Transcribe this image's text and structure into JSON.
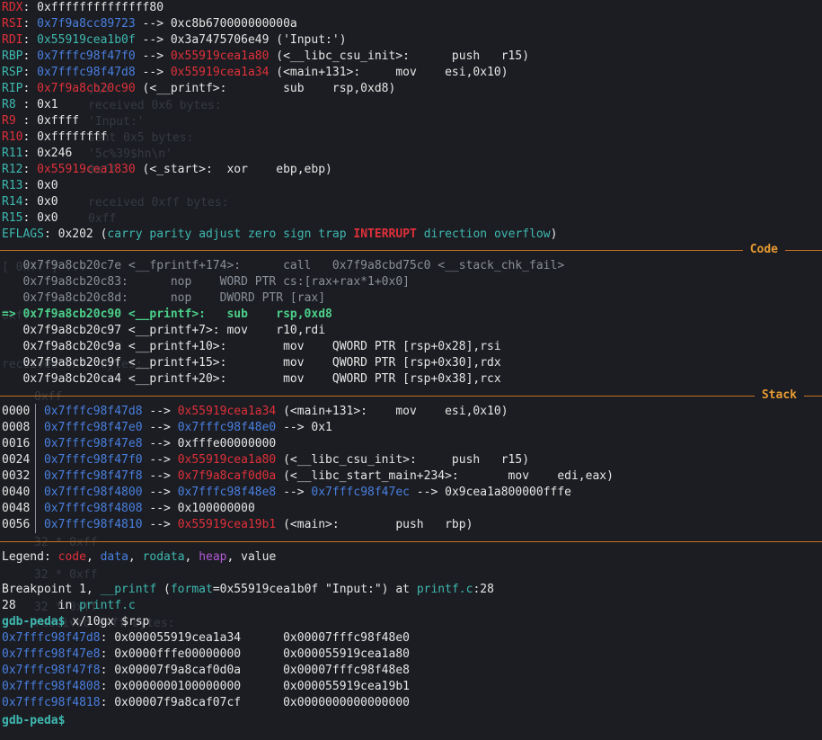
{
  "registers": [
    {
      "name": "RDX",
      "name_color": "red",
      "text": [
        [
          "0xffffffffffffff80",
          "white"
        ]
      ]
    },
    {
      "name": "RSI",
      "name_color": "red",
      "text": [
        [
          "0x7f9a8cc89723",
          "blue"
        ],
        [
          " --> 0xc8b670000000000a",
          "white"
        ]
      ]
    },
    {
      "name": "RDI",
      "name_color": "red",
      "text": [
        [
          "0x55919cea1b0f",
          "teal"
        ],
        [
          " --> 0x3a7475706e49 ('Input:')",
          "white"
        ]
      ]
    },
    {
      "name": "RBP",
      "name_color": "teal",
      "text": [
        [
          "0x7fffc98f47f0",
          "blue"
        ],
        [
          " --> ",
          "white"
        ],
        [
          "0x55919cea1a80",
          "red"
        ],
        [
          " (<__libc_csu_init>:      push   r15)",
          "white"
        ]
      ]
    },
    {
      "name": "RSP",
      "name_color": "teal",
      "text": [
        [
          "0x7fffc98f47d8",
          "blue"
        ],
        [
          " --> ",
          "white"
        ],
        [
          "0x55919cea1a34",
          "red"
        ],
        [
          " (<main+131>:     mov    esi,0x10)",
          "white"
        ]
      ]
    },
    {
      "name": "RIP",
      "name_color": "teal",
      "text": [
        [
          "0x7f9a8cb20c90",
          "red"
        ],
        [
          " (<__printf>:        sub    rsp,0xd8)",
          "white"
        ]
      ]
    },
    {
      "name": "R8 ",
      "name_color": "teal",
      "text": [
        [
          "0x1",
          "white"
        ]
      ]
    },
    {
      "name": "R9 ",
      "name_color": "red",
      "text": [
        [
          "0xffff",
          "white"
        ]
      ]
    },
    {
      "name": "R10",
      "name_color": "red",
      "text": [
        [
          "0xffffffff",
          "white"
        ]
      ]
    },
    {
      "name": "R11",
      "name_color": "teal",
      "text": [
        [
          "0x246",
          "white"
        ]
      ]
    },
    {
      "name": "R12",
      "name_color": "teal",
      "text": [
        [
          "0x55919cea1830",
          "red"
        ],
        [
          " (<_start>:  xor    ebp,ebp)",
          "white"
        ]
      ]
    },
    {
      "name": "R13",
      "name_color": "teal",
      "text": [
        [
          "0x0",
          "white"
        ]
      ]
    },
    {
      "name": "R14",
      "name_color": "teal",
      "text": [
        [
          "0x0",
          "white"
        ]
      ]
    },
    {
      "name": "R15",
      "name_color": "teal",
      "text": [
        [
          "0x0",
          "white"
        ]
      ]
    }
  ],
  "eflags": {
    "label": "EFLAGS",
    "value": "0x202",
    "flags": [
      [
        "carry",
        "teal"
      ],
      [
        "parity",
        "teal"
      ],
      [
        "adjust",
        "teal"
      ],
      [
        "zero",
        "teal"
      ],
      [
        "sign",
        "teal"
      ],
      [
        "trap",
        "teal"
      ],
      [
        "INTERRUPT",
        "red"
      ],
      [
        "direction",
        "teal"
      ],
      [
        "overflow",
        "teal"
      ]
    ]
  },
  "sections": {
    "code": "Code",
    "stack": "Stack"
  },
  "code": [
    {
      "prefix": "   ",
      "text": "0x7f9a8cb20c7e <__fprintf+174>:      ",
      "ins": "call   0x7f9a8cbd75c0 <__stack_chk_fail>",
      "style": "grey"
    },
    {
      "prefix": "   ",
      "text": "0x7f9a8cb20c83:      ",
      "ins": "nop    WORD PTR cs:[rax+rax*1+0x0]",
      "style": "grey"
    },
    {
      "prefix": "   ",
      "text": "0x7f9a8cb20c8d:      ",
      "ins": "nop    DWORD PTR [rax]",
      "style": "grey"
    },
    {
      "prefix": "=> ",
      "text": "0x7f9a8cb20c90 <__printf>:   ",
      "ins": "sub    rsp,0xd8",
      "style": "green"
    },
    {
      "prefix": "   ",
      "text": "0x7f9a8cb20c97 <__printf+7>: ",
      "ins": "mov    r10,rdi",
      "style": "white"
    },
    {
      "prefix": "   ",
      "text": "0x7f9a8cb20c9a <__printf+10>:        ",
      "ins": "mov    QWORD PTR [rsp+0x28],rsi",
      "style": "white"
    },
    {
      "prefix": "   ",
      "text": "0x7f9a8cb20c9f <__printf+15>:        ",
      "ins": "mov    QWORD PTR [rsp+0x30],rdx",
      "style": "white"
    },
    {
      "prefix": "   ",
      "text": "0x7f9a8cb20ca4 <__printf+20>:        ",
      "ins": "mov    QWORD PTR [rsp+0x38],rcx",
      "style": "white"
    }
  ],
  "stack": [
    {
      "off": "0000",
      "parts": [
        [
          "0x7fffc98f47d8",
          "blue"
        ],
        [
          " --> ",
          "white"
        ],
        [
          "0x55919cea1a34",
          "red"
        ],
        [
          " (<main+131>:    mov    esi,0x10)",
          "white"
        ]
      ]
    },
    {
      "off": "0008",
      "parts": [
        [
          "0x7fffc98f47e0",
          "blue"
        ],
        [
          " --> ",
          "white"
        ],
        [
          "0x7fffc98f48e0",
          "blue"
        ],
        [
          " --> 0x1",
          "white"
        ]
      ]
    },
    {
      "off": "0016",
      "parts": [
        [
          "0x7fffc98f47e8",
          "blue"
        ],
        [
          " --> 0xfffe00000000",
          "white"
        ]
      ]
    },
    {
      "off": "0024",
      "parts": [
        [
          "0x7fffc98f47f0",
          "blue"
        ],
        [
          " --> ",
          "white"
        ],
        [
          "0x55919cea1a80",
          "red"
        ],
        [
          " (<__libc_csu_init>:     push   r15)",
          "white"
        ]
      ]
    },
    {
      "off": "0032",
      "parts": [
        [
          "0x7fffc98f47f8",
          "blue"
        ],
        [
          " --> ",
          "white"
        ],
        [
          "0x7f9a8caf0d0a",
          "red"
        ],
        [
          " (<__libc_start_main+234>:       mov    edi,eax)",
          "white"
        ]
      ]
    },
    {
      "off": "0040",
      "parts": [
        [
          "0x7fffc98f4800",
          "blue"
        ],
        [
          " --> ",
          "white"
        ],
        [
          "0x7fffc98f48e8",
          "blue"
        ],
        [
          " --> ",
          "white"
        ],
        [
          "0x7fffc98f47ec",
          "blue"
        ],
        [
          " --> 0x9cea1a800000fffe",
          "white"
        ]
      ]
    },
    {
      "off": "0048",
      "parts": [
        [
          "0x7fffc98f4808",
          "blue"
        ],
        [
          " --> 0x100000000",
          "white"
        ]
      ]
    },
    {
      "off": "0056",
      "parts": [
        [
          "0x7fffc98f4810",
          "blue"
        ],
        [
          " --> ",
          "white"
        ],
        [
          "0x55919cea19b1",
          "red"
        ],
        [
          " (<main>:        push   rbp)",
          "white"
        ]
      ]
    }
  ],
  "legend": {
    "label": "Legend: ",
    "items": [
      [
        "code",
        "red"
      ],
      [
        "data",
        "blue"
      ],
      [
        "rodata",
        "teal"
      ],
      [
        "heap",
        "purple"
      ],
      [
        "value",
        "white"
      ]
    ]
  },
  "breakpoint": {
    "prefix": "Breakpoint 1, ",
    "func": "__printf",
    "args_open": " (",
    "arg_name": "format",
    "arg_val": "=0x55919cea1b0f \"Input:\")",
    "at": " at ",
    "file": "printf.c",
    "line": ":28"
  },
  "source_line": {
    "num": "28",
    "text": "\tin ",
    "file": "printf.c"
  },
  "prompt": "gdb-peda$",
  "command": " x/10gx $rsp",
  "dump": [
    {
      "addr": "0x7fffc98f47d8",
      "v1": "0x000055919cea1a34",
      "v2": "0x00007fffc98f48e0"
    },
    {
      "addr": "0x7fffc98f47e8",
      "v1": "0x0000fffe00000000",
      "v2": "0x000055919cea1a80"
    },
    {
      "addr": "0x7fffc98f47f8",
      "v1": "0x00007f9a8caf0d0a",
      "v2": "0x00007fffc98f48e8"
    },
    {
      "addr": "0x7fffc98f4808",
      "v1": "0x0000000100000000",
      "v2": "0x000055919cea19b1"
    },
    {
      "addr": "0x7fffc98f4818",
      "v1": "0x00007f9a8caf07cf",
      "v2": "0x0000000000000000"
    }
  ],
  "ghost_text": [
    ")\\n'",
    "received 0x6 bytes:",
    "'Input:'",
    "sent 0x5 bytes:",
    "'5c%39$hn\\n'",
    "0xff",
    "received 0xff bytes:",
    "0xff",
    "[ 0xff ] ...",
    "0xff",
    "received 0xff bytes:",
    "0xff",
    "32 * 0xff",
    "32 * 0xff",
    "32 * 0xff",
    "received 0xff bytes:"
  ]
}
